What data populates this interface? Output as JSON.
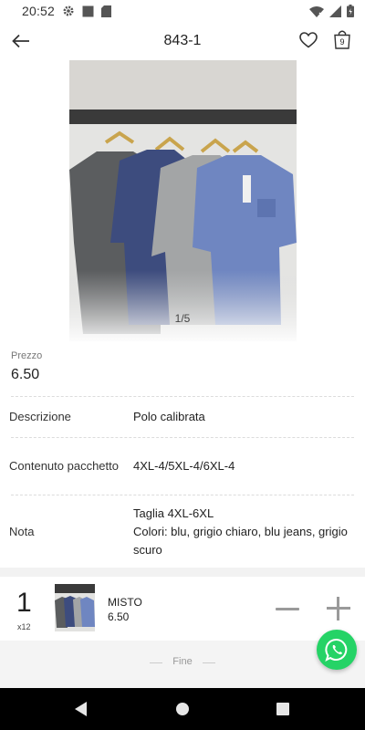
{
  "status_bar": {
    "time": "20:52",
    "icons": [
      "gear-icon",
      "square-icon",
      "sd-card-icon",
      "wifi-icon",
      "signal-icon",
      "battery-icon"
    ]
  },
  "app_bar": {
    "title": "843-1",
    "back_icon": "arrow-left-icon",
    "favorite_icon": "heart-icon",
    "cart_icon": "shopping-bag-icon",
    "cart_count": "9"
  },
  "gallery": {
    "page_indicator": "1/5"
  },
  "product": {
    "price_label": "Prezzo",
    "price_value": "6.50",
    "details": [
      {
        "label": "Descrizione",
        "value": "Polo calibrata"
      },
      {
        "label": "Contenuto pacchetto",
        "value": "4XL-4/5XL-4/6XL-4"
      },
      {
        "label": "Nota",
        "value_lines": [
          "Taglia 4XL-6XL",
          "Colori: blu, grigio chiaro, blu jeans, grigio scuro"
        ]
      }
    ]
  },
  "cart_row": {
    "quantity": "1",
    "multiplier": "x12",
    "name": "MISTO",
    "price": "6.50"
  },
  "footer": {
    "end_text": "Fine"
  },
  "colors": {
    "whatsapp": "#25d366",
    "nav_bar": "#000000",
    "control_gray": "#9a9a9a"
  }
}
